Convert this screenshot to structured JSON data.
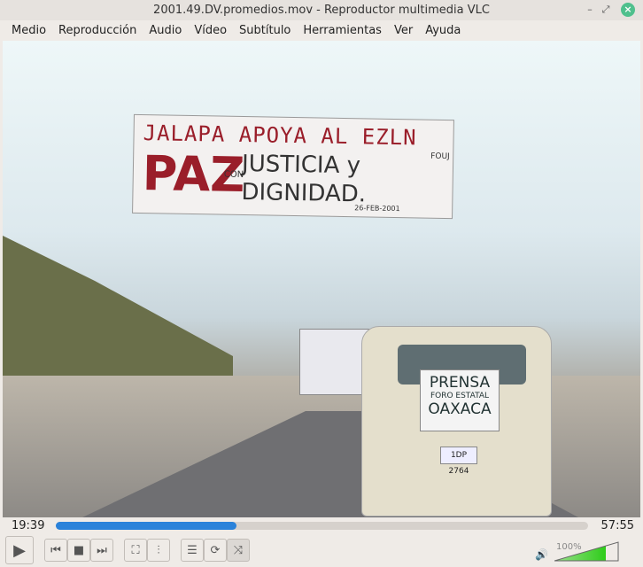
{
  "window": {
    "title": "2001.49.DV.promedios.mov - Reproductor multimedia VLC"
  },
  "menu": [
    "Medio",
    "Reproducción",
    "Audio",
    "Vídeo",
    "Subtítulo",
    "Herramientas",
    "Ver",
    "Ayuda"
  ],
  "video": {
    "banner": {
      "line1": "JALAPA APOYA AL EZLN",
      "paz": "PAZ",
      "con": "CON",
      "justicia": "JUSTICIA y",
      "dignidad": "DIGNIDAD.",
      "fouj": "FOUJ",
      "date": "26-FEB-2001"
    },
    "sign": {
      "top": "PRENSA",
      "mid": "FORO ESTATAL",
      "bottom": "OAXACA"
    },
    "plate": "1DP 2764"
  },
  "seek": {
    "elapsed": "19:39",
    "total": "57:55",
    "progress": 0.339
  },
  "volume": {
    "label": "100%",
    "level": 1.0
  },
  "colors": {
    "accent": "#2a82da",
    "volume": "#2ecc1a"
  }
}
